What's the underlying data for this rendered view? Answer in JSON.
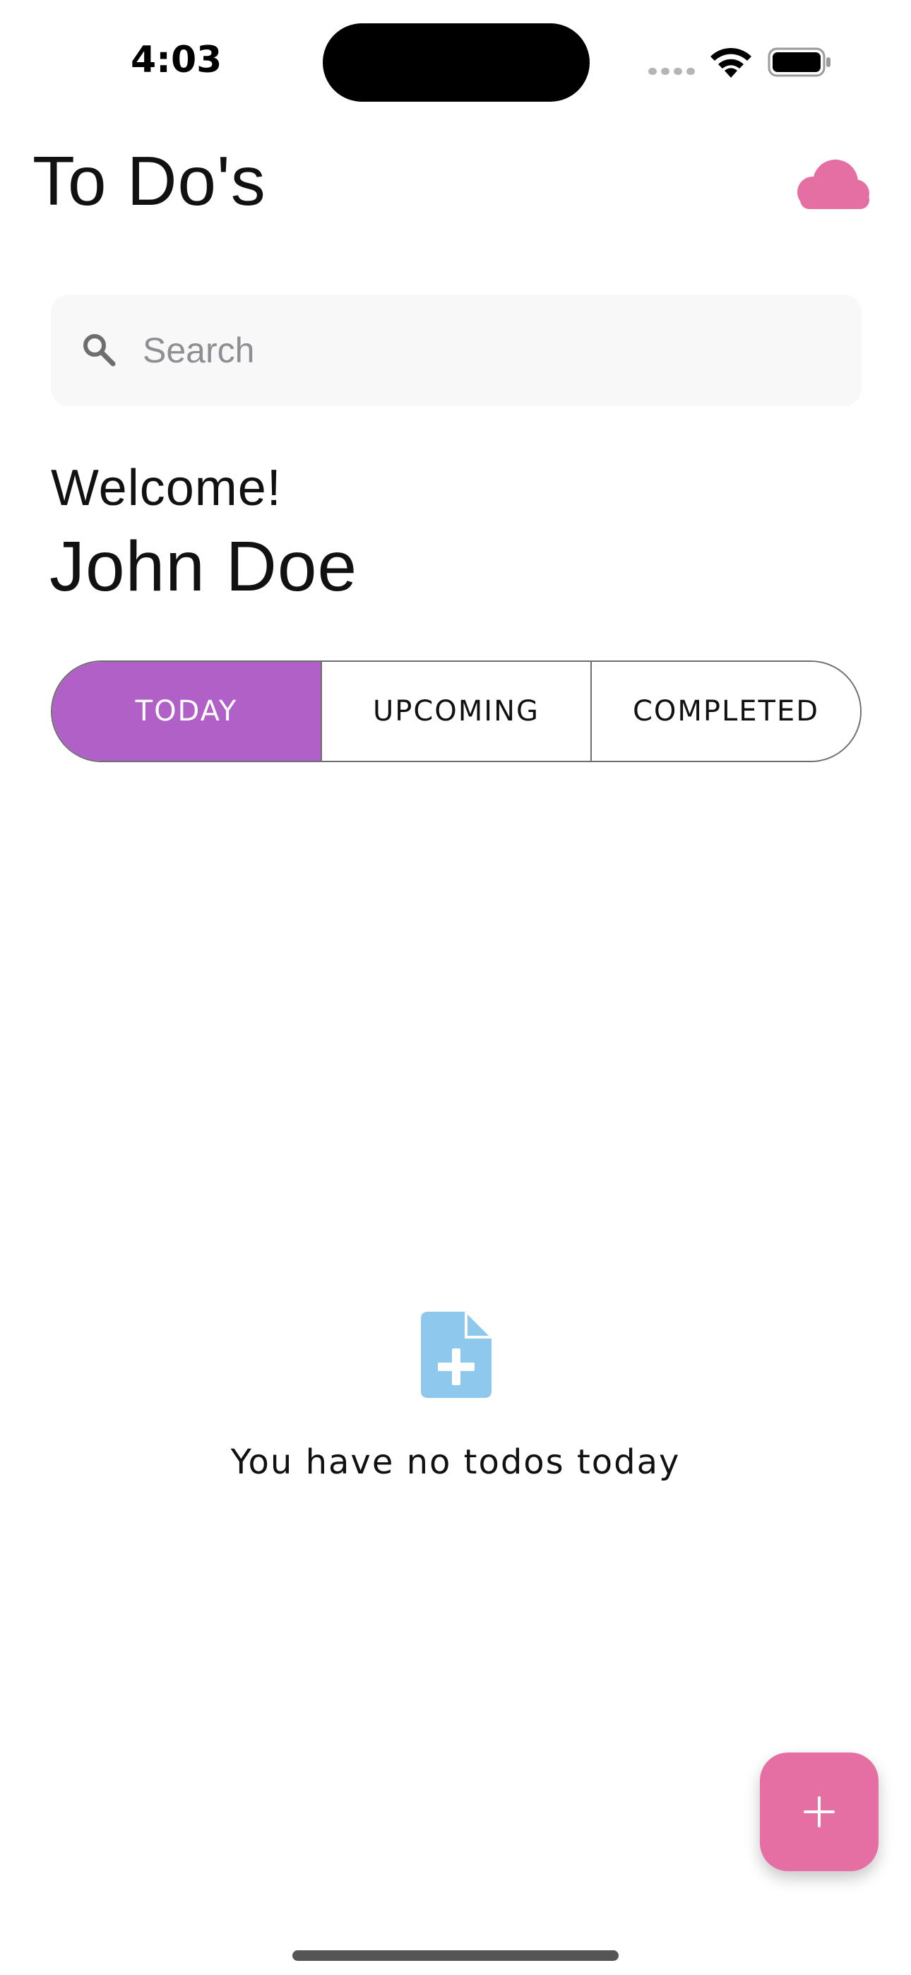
{
  "status_bar": {
    "time": "4:03"
  },
  "header": {
    "title": "To Do's",
    "cloud_icon": "cloud-icon"
  },
  "search": {
    "placeholder": "Search",
    "value": ""
  },
  "welcome": {
    "greeting": "Welcome!",
    "name": "John Doe"
  },
  "tabs": [
    {
      "label": "TODAY",
      "active": true
    },
    {
      "label": "UPCOMING",
      "active": false
    },
    {
      "label": "COMPLETED",
      "active": false
    }
  ],
  "empty_state": {
    "icon": "file-plus-icon",
    "message": "You have no todos today"
  },
  "fab": {
    "icon": "plus-icon"
  },
  "colors": {
    "accent_purple": "#b060c6",
    "accent_pink": "#e56fa2",
    "empty_icon_blue": "#8ec8ec",
    "search_bg": "#f8f8f8"
  }
}
